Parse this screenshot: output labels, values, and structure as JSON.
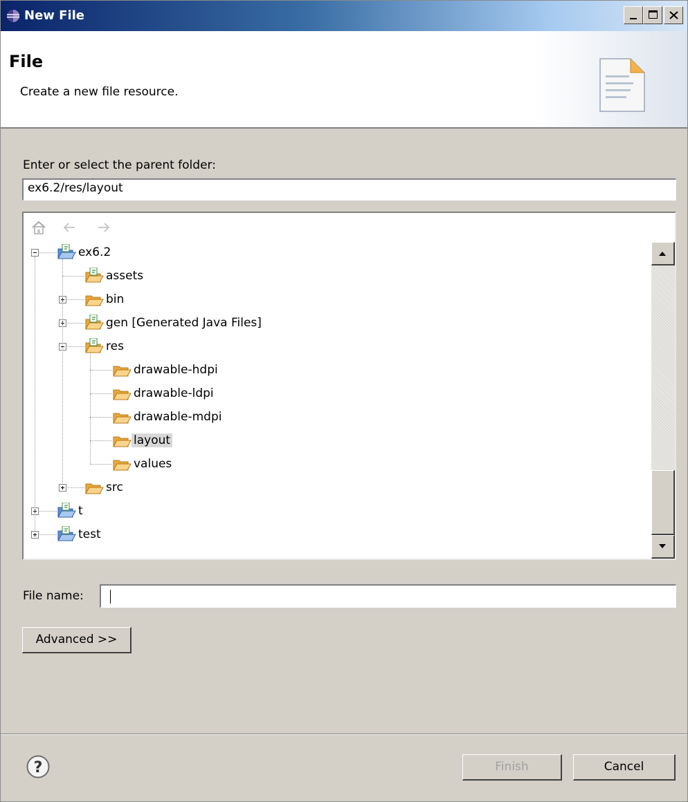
{
  "window": {
    "title": "New File"
  },
  "banner": {
    "title": "File",
    "description": "Create a new file resource."
  },
  "parent": {
    "label": "Enter or select the parent folder:",
    "value": "ex6.2/res/layout"
  },
  "tree": {
    "nodes": [
      {
        "label": "ex6.2",
        "kind": "project",
        "expanded": true
      },
      {
        "label": "assets",
        "kind": "source-folder"
      },
      {
        "label": "bin",
        "kind": "folder",
        "expanded": false
      },
      {
        "label": "gen [Generated Java Files]",
        "kind": "source-folder",
        "expanded": false
      },
      {
        "label": "res",
        "kind": "source-folder",
        "expanded": true
      },
      {
        "label": "drawable-hdpi",
        "kind": "folder"
      },
      {
        "label": "drawable-ldpi",
        "kind": "folder"
      },
      {
        "label": "drawable-mdpi",
        "kind": "folder"
      },
      {
        "label": "layout",
        "kind": "folder",
        "selected": true
      },
      {
        "label": "values",
        "kind": "folder"
      },
      {
        "label": "src",
        "kind": "folder",
        "expanded": false
      },
      {
        "label": "t",
        "kind": "project",
        "expanded": false
      },
      {
        "label": "test",
        "kind": "project",
        "expanded": false
      }
    ]
  },
  "filename": {
    "label": "File name:",
    "value": ""
  },
  "buttons": {
    "advanced": "Advanced >>",
    "finish": "Finish",
    "cancel": "Cancel"
  },
  "icons": {
    "window": "eclipse-icon",
    "banner": "document-icon",
    "home": "home-icon",
    "back": "back-arrow-icon",
    "forward": "forward-arrow-icon",
    "help": "help-icon"
  },
  "colors": {
    "title_bar": "#0a246a",
    "selection": "#d8d8d8",
    "folder": "#f0b64a"
  }
}
